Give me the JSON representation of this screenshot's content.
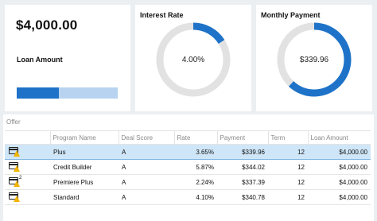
{
  "loan": {
    "amount": "$4,000.00",
    "label": "Loan Amount",
    "progress": 0.42
  },
  "rate_card": {
    "title": "Interest Rate",
    "value": "4.00%",
    "fraction": 0.16,
    "color": "#1e73c9"
  },
  "payment_card": {
    "title": "Monthly Payment",
    "value": "$339.96",
    "fraction": 0.62,
    "color": "#1e73c9"
  },
  "offers": {
    "title": "Offer",
    "columns": [
      "",
      "Program Name",
      "Deal Score",
      "Rate",
      "Payment",
      "Term",
      "Loan Amount"
    ],
    "rows": [
      {
        "icon": "card-warning-icon",
        "badge": "",
        "program": "Plus",
        "score": "A",
        "rate": "3.65%",
        "payment": "$339.96",
        "term": "12",
        "amount": "$4,000.00",
        "selected": true
      },
      {
        "icon": "card-warning-icon",
        "badge": "",
        "program": "Credit Builder",
        "score": "A",
        "rate": "5.87%",
        "payment": "$344.02",
        "term": "12",
        "amount": "$4,000.00",
        "selected": false
      },
      {
        "icon": "card-warning-icon",
        "badge": "2",
        "program": "Premiere Plus",
        "score": "A",
        "rate": "2.24%",
        "payment": "$337.39",
        "term": "12",
        "amount": "$4,000.00",
        "selected": false
      },
      {
        "icon": "card-warning-icon",
        "badge": "",
        "program": "Standard",
        "score": "A",
        "rate": "4.10%",
        "payment": "$340.78",
        "term": "12",
        "amount": "$4,000.00",
        "selected": false
      }
    ]
  }
}
